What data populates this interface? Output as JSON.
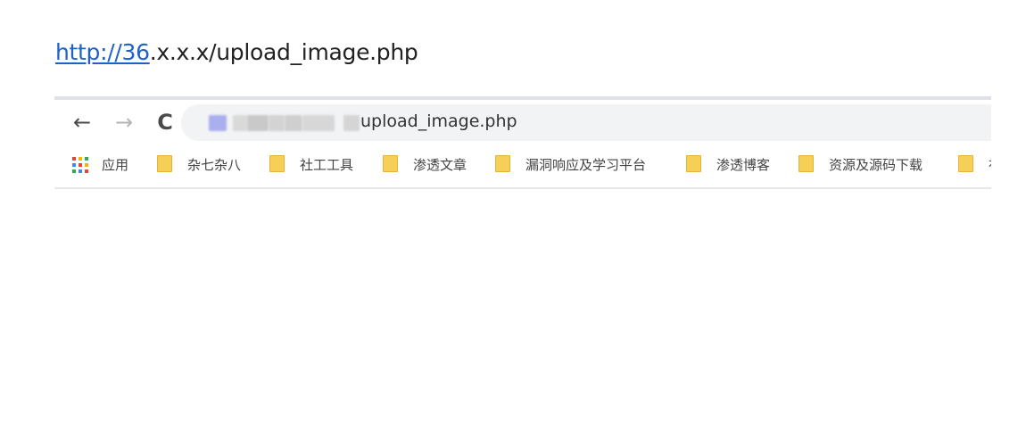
{
  "doc": {
    "link_text": "http://36",
    "url_rest": ".x.x.x/upload_image.php"
  },
  "browser": {
    "nav": {
      "back": "←",
      "forward": "→",
      "reload": "C"
    },
    "address_bar": {
      "visible_url": "upload_image.php"
    },
    "bookmarks": {
      "apps_label": "应用",
      "items": [
        "杂七杂八",
        "社工工具",
        "渗透文章",
        "漏洞响应及学习平台",
        "渗透博客",
        "资源及源码下载",
        "社"
      ]
    }
  },
  "colors": {
    "link": "#1e62c8",
    "folder": "#f6cf57",
    "omnibox_bg": "#f1f3f4"
  }
}
